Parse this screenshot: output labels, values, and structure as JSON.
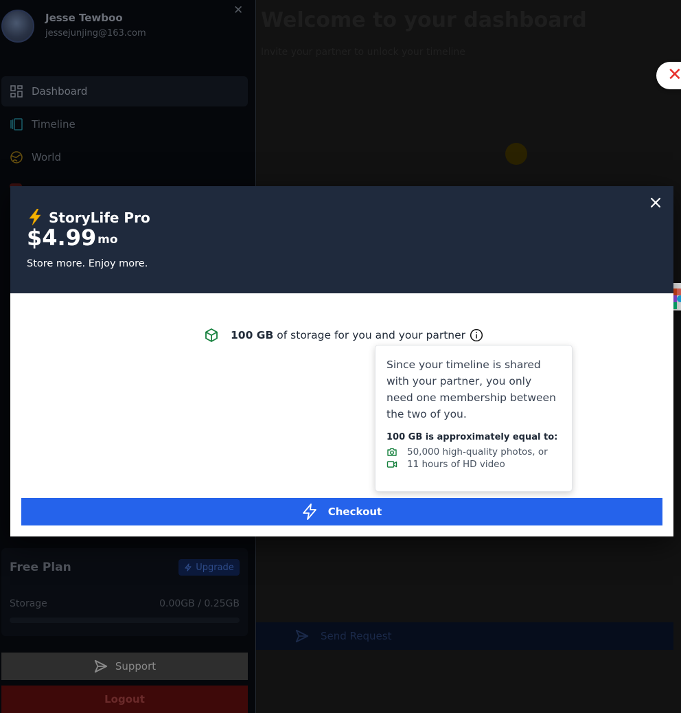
{
  "user": {
    "name": "Jesse Tewboo",
    "email": "jessejunjing@163.com"
  },
  "sidebar": {
    "close_icon": "close-icon",
    "nav": [
      {
        "label": "Dashboard",
        "icon": "grid-icon",
        "active": true
      },
      {
        "label": "Timeline",
        "icon": "timeline-icon",
        "active": false
      },
      {
        "label": "World",
        "icon": "globe-icon",
        "active": false
      }
    ],
    "plan": {
      "title": "Free Plan",
      "upgrade_label": "Upgrade",
      "storage_label": "Storage",
      "storage_value": "0.00GB / 0.25GB",
      "storage_fraction": 0.0
    },
    "support_label": "Support",
    "logout_label": "Logout"
  },
  "main": {
    "welcome_title": "Welcome to your dashboard",
    "welcome_subtitle": "Invite your partner to unlock your timeline",
    "send_request_label": "Send Request"
  },
  "modal": {
    "plan_name": "StoryLife Pro",
    "price": "$4.99",
    "per": "/ mo",
    "tagline": "Store more. Enjoy more.",
    "feature": {
      "amount": "100 GB",
      "text": "of storage for you and your partner"
    },
    "tooltip": {
      "text": "Since your timeline is shared with your partner, you only need one membership between the two of you.",
      "heading": "100 GB is approximately equal to:",
      "items": [
        {
          "icon": "camera-icon",
          "text": "50,000 high-quality photos, or"
        },
        {
          "icon": "video-icon",
          "text": "11 hours of HD video"
        }
      ]
    },
    "checkout_label": "Checkout"
  },
  "colors": {
    "modal_header": "#1f2a3d",
    "accent": "#2563eb",
    "feature_green": "#15803d",
    "bolt_yellow": "#f5b301"
  }
}
